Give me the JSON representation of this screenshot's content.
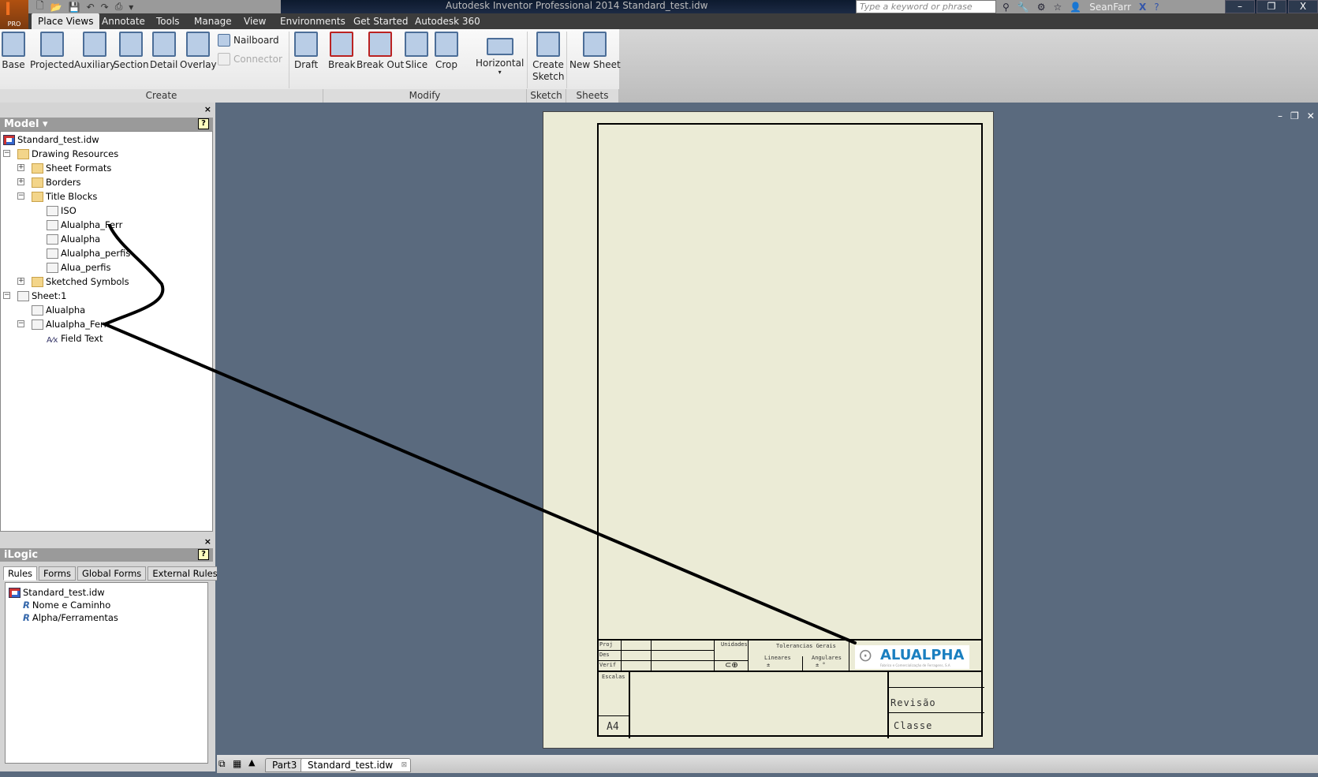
{
  "title_bar": {
    "app_title": "Autodesk Inventor Professional 2014    Standard_test.idw",
    "search_placeholder": "Type a keyword or phrase",
    "user": "SeanFarr",
    "logo_label": "PRO",
    "window_controls": [
      "–",
      "❐",
      "X"
    ]
  },
  "tabs": [
    "Place Views",
    "Annotate",
    "Tools",
    "Manage",
    "View",
    "Environments",
    "Get Started",
    "Autodesk 360"
  ],
  "ribbon": {
    "create": {
      "label": "Create",
      "buttons": [
        "Base",
        "Projected",
        "Auxiliary",
        "Section",
        "Detail",
        "Overlay"
      ],
      "small": [
        "Nailboard",
        "Connector"
      ],
      "draft": "Draft"
    },
    "modify": {
      "label": "Modify",
      "buttons": [
        "Break",
        "Break Out",
        "Slice",
        "Crop",
        "Horizontal"
      ]
    },
    "sketch": {
      "label": "Sketch",
      "button": "Create Sketch"
    },
    "sheets": {
      "label": "Sheets",
      "button": "New Sheet"
    }
  },
  "model_panel": {
    "title": "Model ▾",
    "help": "?",
    "close": "×",
    "tree": [
      "Standard_test.idw",
      "Drawing Resources",
      "Sheet Formats",
      "Borders",
      "Title Blocks",
      "ISO",
      "Alualpha_Ferr",
      "Alualpha",
      "Alualpha_perfis",
      "Alua_perfis",
      "Sketched Symbols",
      "Sheet:1",
      "Alualpha",
      "Alualpha_Ferr",
      "Field Text"
    ]
  },
  "ilogic_panel": {
    "title": "iLogic",
    "help": "?",
    "close": "×",
    "tabs": [
      "Rules",
      "Forms",
      "Global Forms",
      "External Rules"
    ],
    "items": [
      "Standard_test.idw",
      "Nome e Caminho",
      "Alpha/Ferramentas"
    ]
  },
  "title_block": {
    "proj": "Proj",
    "des": "Des",
    "verif": "Verif",
    "unidades": "Unidades",
    "tolerancias": "Tolerancias Gerais",
    "lineares": "Lineares",
    "angulares": "Angulares",
    "lin_val": "±",
    "ang_val": "± °",
    "escalas": "Escalas",
    "size": "A4",
    "revisao": "Revisão",
    "classe": "Classe",
    "logo_text": "ALUALPHA",
    "logo_sub": "Fabrico e Comercialização de Ferragens, S.A"
  },
  "status_bar": {
    "doc_tabs": [
      "Part3",
      "Standard_test.idw"
    ]
  },
  "colors": {
    "canvas": "#5a6a7e",
    "sheet": "#ebebd6",
    "logo": "#1a7fc0"
  }
}
